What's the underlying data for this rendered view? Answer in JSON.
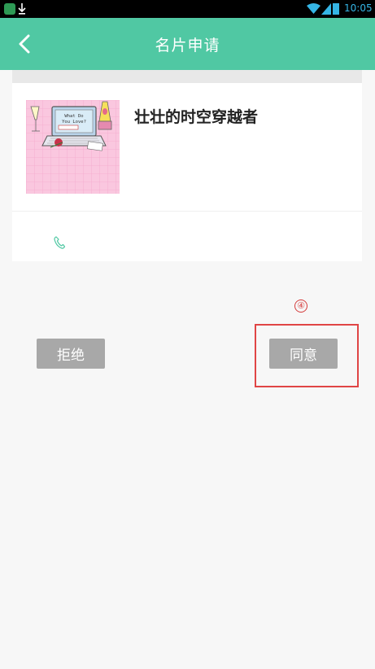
{
  "status_bar": {
    "time": "10:05",
    "icons": [
      "app-notification-icon",
      "download-icon",
      "wifi-icon",
      "signal-icon",
      "battery-icon"
    ]
  },
  "header": {
    "title": "名片申请",
    "back_icon": "chevron-left-icon",
    "background_color": "#50c8a3"
  },
  "card": {
    "name": "壮壮的时空穿越者",
    "avatar_caption": "What Do You Love?",
    "phone_icon": "phone-icon",
    "phone_icon_color": "#50c8a3"
  },
  "annotation": {
    "number": "④",
    "color": "#e04545"
  },
  "actions": {
    "reject_label": "拒绝",
    "agree_label": "同意",
    "button_color": "#a8a8a8"
  }
}
